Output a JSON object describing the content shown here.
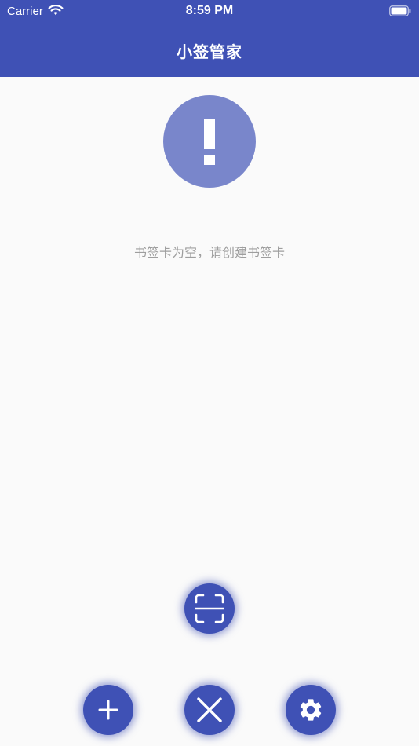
{
  "status_bar": {
    "carrier": "Carrier",
    "time": "8:59 PM",
    "wifi_icon": "wifi-icon",
    "battery_icon": "battery-full-icon"
  },
  "app_bar": {
    "title": "小签管家"
  },
  "empty_state": {
    "icon": "exclamation-icon",
    "message": "书签卡为空，请创建书签卡"
  },
  "fabs": {
    "scan_icon": "scan-icon",
    "add_icon": "plus-icon",
    "close_icon": "close-icon",
    "settings_icon": "gear-icon"
  },
  "colors": {
    "primary": "#3f51b5",
    "empty_icon_bg": "#7986cb",
    "background": "#fafafa",
    "message_text": "#9e9e9e"
  }
}
